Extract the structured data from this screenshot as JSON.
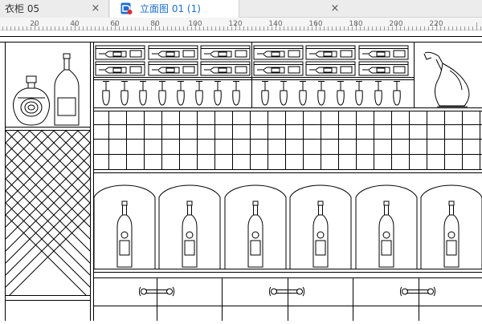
{
  "tabs": [
    {
      "label": "衣柜 05",
      "close": "×",
      "active": false
    },
    {
      "label": "立面图 01 (1)",
      "close": "×",
      "active": true
    }
  ],
  "ruler": {
    "labels": [
      "20",
      "40",
      "60",
      "80",
      "100",
      "120",
      "140",
      "160",
      "180",
      "200",
      "220"
    ]
  },
  "colors": {
    "accent": "#1b6fd1",
    "tab_bg": "#ececec",
    "line": "#000000"
  },
  "icons": {
    "app": "document-icon",
    "close": "close-icon"
  }
}
